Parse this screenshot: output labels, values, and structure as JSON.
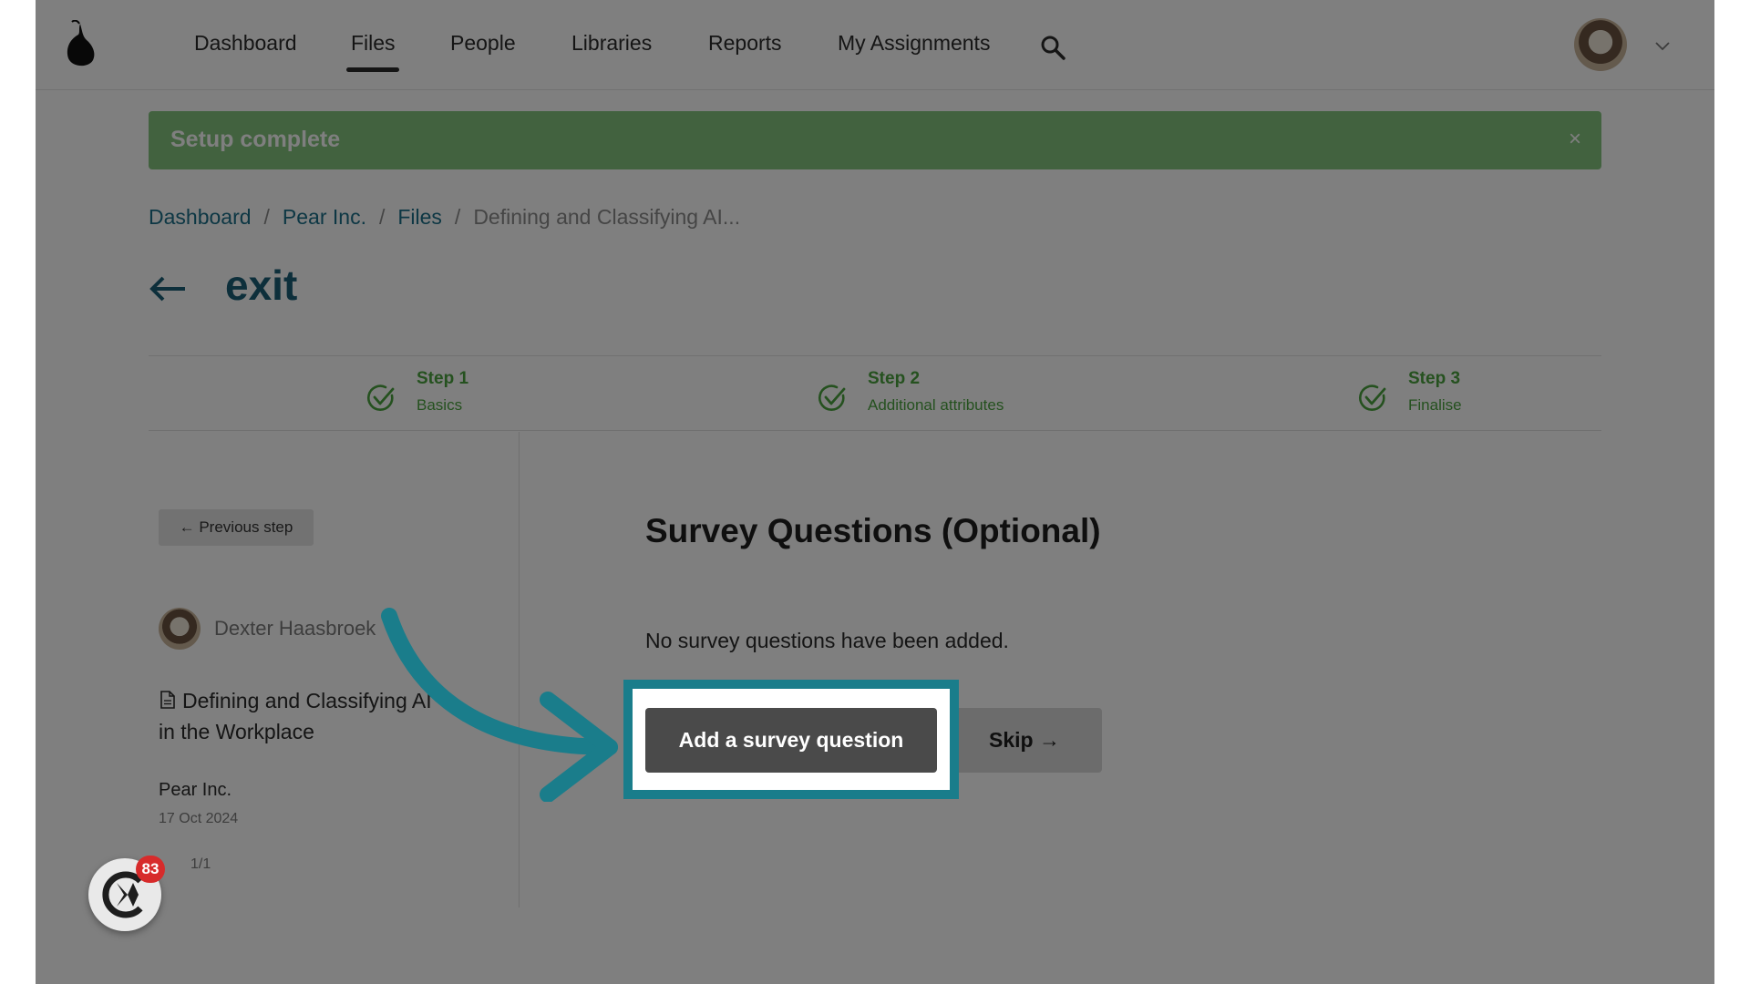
{
  "nav": {
    "items": [
      {
        "label": "Dashboard"
      },
      {
        "label": "Files"
      },
      {
        "label": "People"
      },
      {
        "label": "Libraries"
      },
      {
        "label": "Reports"
      },
      {
        "label": "My Assignments"
      }
    ],
    "active": "Files",
    "search_icon": "search-icon",
    "menu_icon": "chevron-down-icon"
  },
  "banner": {
    "text": "Setup complete",
    "close": "×"
  },
  "breadcrumb": {
    "items": [
      "Dashboard",
      "Pear Inc.",
      "Files"
    ],
    "separator": "/",
    "current": "Defining and Classifying AI..."
  },
  "header": {
    "title": "exit"
  },
  "stepper": {
    "steps": [
      {
        "title": "Step 1",
        "subtitle": "Basics"
      },
      {
        "title": "Step 2",
        "subtitle": "Additional attributes"
      },
      {
        "title": "Step 3",
        "subtitle": "Finalise"
      }
    ]
  },
  "sidebar": {
    "previous_label": "← Previous step",
    "author": "Dexter Haasbroek",
    "document_title": "Defining and Classifying AI in the Workplace",
    "organization": "Pear Inc.",
    "date": "17 Oct 2024",
    "page": "1/1"
  },
  "main": {
    "title": "Survey Questions (Optional)",
    "empty_message": "No survey questions have been added.",
    "add_label": "Add a survey question",
    "skip_label": "Skip →"
  },
  "chat": {
    "badge": "83"
  },
  "colors": {
    "banner": "#84c47f",
    "link": "#1b6f89",
    "step_green": "#4aa23e",
    "highlight": "#1a7d8b",
    "badge": "#d72b2b"
  }
}
